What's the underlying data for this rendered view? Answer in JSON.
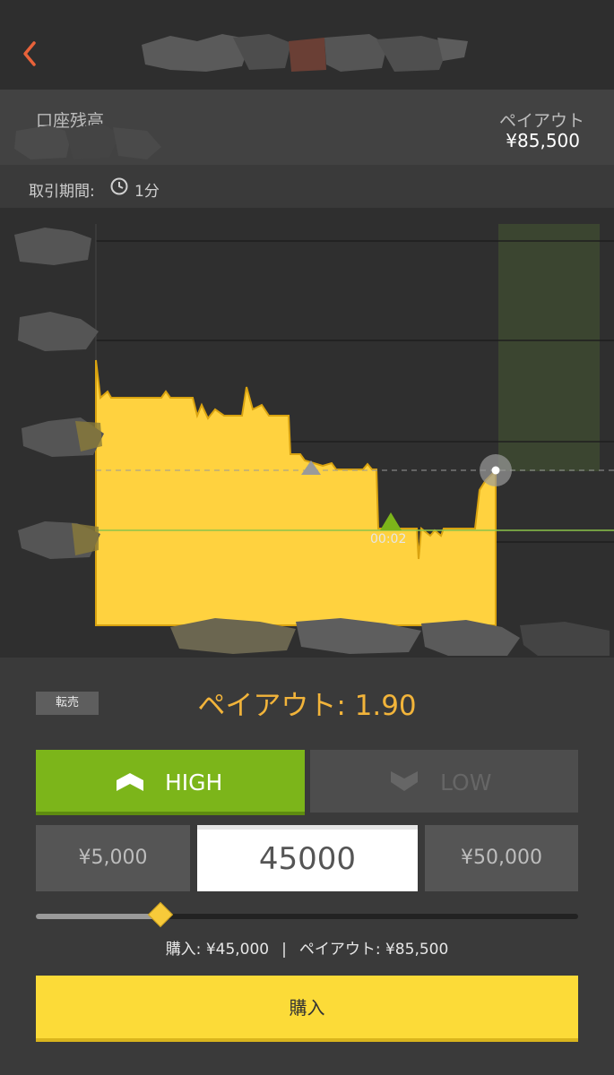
{
  "header": {
    "back_icon": "chevron-left-icon",
    "accent_color": "#e8623a"
  },
  "account": {
    "balance_label": "口座残高",
    "payout_label": "ペイアウト",
    "payout_value": "¥85,500"
  },
  "trade_period": {
    "label": "取引期間:",
    "icon": "clock-icon",
    "value": "1分"
  },
  "chart": {
    "timer_label": "00:02",
    "area_color": "#ffd23f",
    "line_color": "#8bc34a"
  },
  "panel": {
    "resale_label": "転売",
    "payout_rate": "ペイアウト: 1.90",
    "high_label": "HIGH",
    "low_label": "LOW",
    "amount_minus": "¥5,000",
    "amount_value": "45000",
    "amount_plus": "¥50,000",
    "slider_fraction": 0.23,
    "summary_purchase": "購入: ¥45,000",
    "summary_separator": "|",
    "summary_payout": "ペイアウト: ¥85,500",
    "buy_label": "購入",
    "colors": {
      "high": "#7cb51a",
      "buy": "#fcdb38",
      "payout_text": "#f2b43a"
    }
  }
}
